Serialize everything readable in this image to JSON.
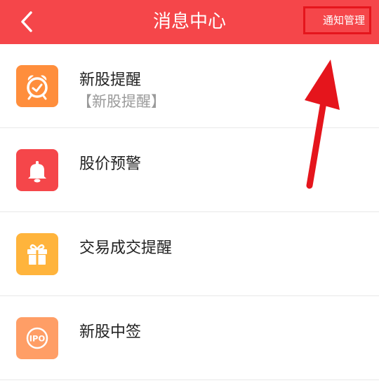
{
  "header": {
    "title": "消息中心",
    "notify_manage_label": "通知管理"
  },
  "items": [
    {
      "title": "新股提醒",
      "subtitle": "【新股提醒】",
      "icon": "alarm-clock-icon",
      "color": "#ff8e3c"
    },
    {
      "title": "股价预警",
      "icon": "bell-icon",
      "color": "#f5464a"
    },
    {
      "title": "交易成交提醒",
      "icon": "gift-icon",
      "color": "#ffb43c"
    },
    {
      "title": "新股中签",
      "icon": "ipo-icon",
      "color": "#ff9e66",
      "icon_text": "IPO"
    }
  ],
  "colors": {
    "header_bg": "#f5464a",
    "annotation": "#e5151c"
  }
}
